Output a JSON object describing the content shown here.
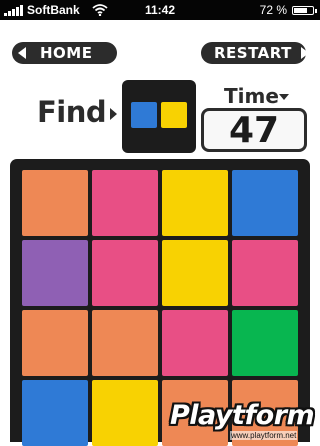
{
  "status_bar": {
    "carrier": "SoftBank",
    "time": "11:42",
    "battery_percent": "72 %",
    "battery_level": 0.72,
    "icons": [
      "signal-bars-icon",
      "wifi-icon",
      "battery-icon"
    ]
  },
  "nav": {
    "home_label": "HOME",
    "restart_label": "RESTART"
  },
  "find": {
    "label": "Find",
    "target_colors": [
      "#2f7ad6",
      "#f8d202"
    ]
  },
  "timer": {
    "label": "Time",
    "value": "47"
  },
  "grid": {
    "columns": 4,
    "visible_rows": 4,
    "cells": [
      "#ee8855",
      "#e84f85",
      "#f8d202",
      "#2f7ad6",
      "#8f60b4",
      "#e84f85",
      "#f8d202",
      "#e84f85",
      "#ee8855",
      "#ee8855",
      "#e84f85",
      "#08b650",
      "#2f7ad6",
      "#f8d202",
      "#ee8855",
      "#ee8855"
    ]
  },
  "watermark": {
    "brand": "Playtform",
    "url": "www.playtform.net"
  }
}
